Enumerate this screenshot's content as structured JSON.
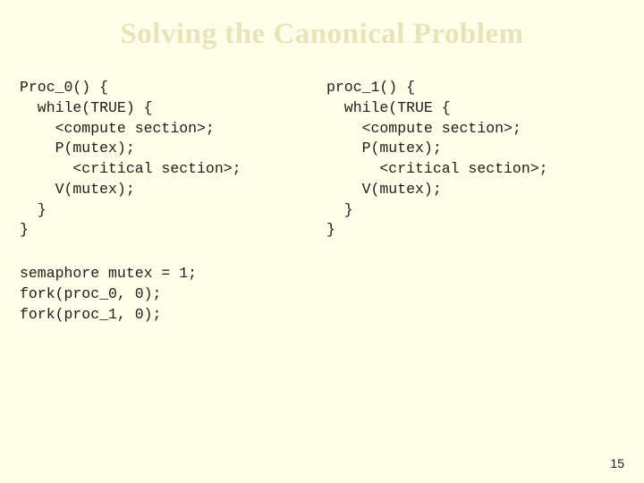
{
  "title": "Solving the Canonical Problem",
  "left": {
    "l1": "Proc_0() {",
    "l2": "  while(TRUE) {",
    "l3": "    <compute section>;",
    "l4": "    P(mutex);",
    "l5": "      <critical section>;",
    "l6": "    V(mutex);",
    "l7": "  }",
    "l8": "}"
  },
  "right": {
    "l1": "proc_1() {",
    "l2": "  while(TRUE {",
    "l3": "    <compute section>;",
    "l4": "    P(mutex);",
    "l5": "      <critical section>;",
    "l6": "    V(mutex);",
    "l7": "  }",
    "l8": "}"
  },
  "footer": {
    "l1": "semaphore mutex = 1;",
    "l2": "fork(proc_0, 0);",
    "l3": "fork(proc_1, 0);"
  },
  "page": "15"
}
